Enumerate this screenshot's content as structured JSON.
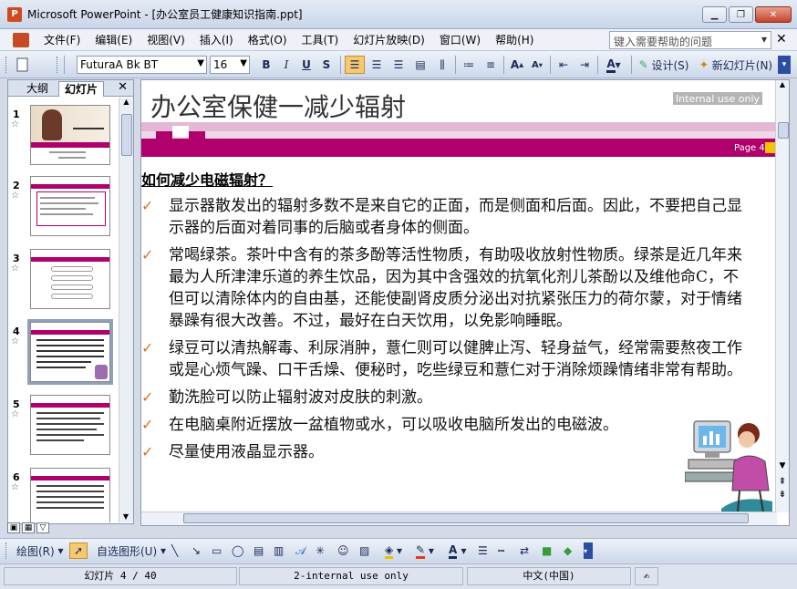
{
  "window": {
    "title": "Microsoft PowerPoint - [办公室员工健康知识指南.ppt]",
    "controls": {
      "minimize": "▁",
      "restore": "❐",
      "close": "✕"
    }
  },
  "menu": {
    "items": [
      "文件(F)",
      "编辑(E)",
      "视图(V)",
      "插入(I)",
      "格式(O)",
      "工具(T)",
      "幻灯片放映(D)",
      "窗口(W)",
      "帮助(H)"
    ],
    "help_placeholder": "键入需要帮助的问题",
    "close_glyph": "✕"
  },
  "toolbar": {
    "font_name": "FuturaA Bk BT",
    "font_size": "16",
    "bold": "B",
    "italic": "I",
    "underline": "U",
    "shadow": "S",
    "design_label": "设计(S)",
    "new_slide_label": "新幻灯片(N)"
  },
  "left_pane": {
    "tab_outline": "大纲",
    "tab_slides": "幻灯片",
    "close_glyph": "✕",
    "slides": [
      {
        "num": "1",
        "star": "☆"
      },
      {
        "num": "2",
        "star": "☆"
      },
      {
        "num": "3",
        "star": "☆"
      },
      {
        "num": "4",
        "star": "☆"
      },
      {
        "num": "5",
        "star": "☆"
      },
      {
        "num": "6",
        "star": "☆"
      }
    ]
  },
  "slide": {
    "title": "办公室保健一减少辐射",
    "badge": "Internal use only",
    "page_label": "Page 4",
    "heading": "如何减少电磁辐射？",
    "bullet_glyph": "✓",
    "bullets": [
      "显示器散发出的辐射多数不是来自它的正面，而是侧面和后面。因此，不要把自己显示器的后面对着同事的后脑或者身体的侧面。",
      "常喝绿茶。茶叶中含有的茶多酚等活性物质，有助吸收放射性物质。绿茶是近几年来最为人所津津乐道的养生饮品，因为其中含强效的抗氧化剂儿茶酚以及维他命C，不但可以清除体内的自由基，还能使副肾皮质分泌出对抗紧张压力的荷尔蒙，对于情绪暴躁有很大改善。不过，最好在白天饮用，以免影响睡眠。",
      "绿豆可以清热解毒、利尿消肿，薏仁则可以健脾止泻、轻身益气，经常需要熬夜工作或是心烦气躁、口干舌燥、便秘时，吃些绿豆和薏仁对于消除烦躁情绪非常有帮助。",
      "勤洗脸可以防止辐射波对皮肤的刺激。",
      "在电脑桌附近摆放一盆植物或水，可以吸收电脑所发出的电磁波。",
      "尽量使用液晶显示器。"
    ]
  },
  "drawbar": {
    "draw_label": "绘图(R)",
    "autoshapes_label": "自选图形(U)"
  },
  "status": {
    "slide_pos": "幻灯片 4 / 40",
    "design": "2-internal use only",
    "language": "中文(中国)"
  },
  "colors": {
    "accent_magenta": "#b0006b",
    "bullet_orange": "#e07020",
    "page_yellow": "#f5c400"
  }
}
